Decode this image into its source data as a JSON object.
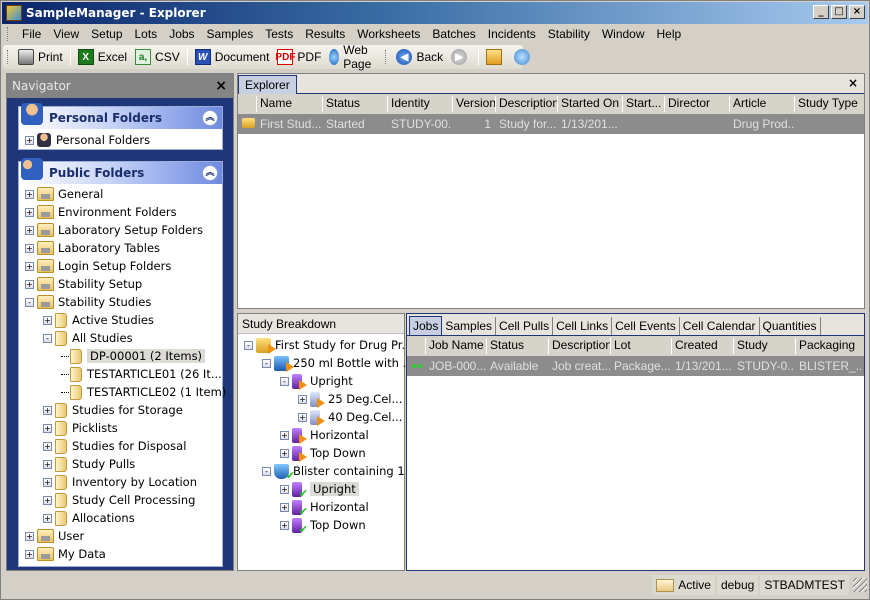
{
  "window": {
    "title": "SampleManager - Explorer",
    "controls": [
      "_",
      "□",
      "×"
    ]
  },
  "menubar": {
    "items": [
      "File",
      "View",
      "Setup",
      "Lots",
      "Jobs",
      "Samples",
      "Tests",
      "Results",
      "Worksheets",
      "Batches",
      "Incidents",
      "Stability",
      "Window",
      "Help"
    ]
  },
  "toolbar": {
    "print": "Print",
    "excel": "Excel",
    "csv": "CSV",
    "document": "Document",
    "pdf": "PDF",
    "webpage": "Web Page",
    "back": "Back"
  },
  "navigator": {
    "title": "Navigator",
    "close": "×",
    "personal": {
      "header": "Personal Folders",
      "items": [
        {
          "label": "Personal Folders"
        }
      ]
    },
    "public": {
      "header": "Public Folders",
      "items": [
        {
          "label": "General",
          "level": 0,
          "exp": "+"
        },
        {
          "label": "Environment Folders",
          "level": 0,
          "exp": "+"
        },
        {
          "label": "Laboratory Setup Folders",
          "level": 0,
          "exp": "+"
        },
        {
          "label": "Laboratory Tables",
          "level": 0,
          "exp": "+"
        },
        {
          "label": "Login Setup Folders",
          "level": 0,
          "exp": "+"
        },
        {
          "label": "Stability Setup",
          "level": 0,
          "exp": "+"
        },
        {
          "label": "Stability Studies",
          "level": 0,
          "exp": "-"
        },
        {
          "label": "Active Studies",
          "level": 1,
          "exp": "+"
        },
        {
          "label": "All Studies",
          "level": 1,
          "exp": "-"
        },
        {
          "label": "DP-00001 (2 Items)",
          "level": 2,
          "exp": "",
          "selected": true
        },
        {
          "label": "TESTARTICLE01 (26 It...",
          "level": 2,
          "exp": ""
        },
        {
          "label": "TESTARTICLE02 (1 Item)",
          "level": 2,
          "exp": ""
        },
        {
          "label": "Studies for Storage",
          "level": 1,
          "exp": "+"
        },
        {
          "label": "Picklists",
          "level": 1,
          "exp": "+"
        },
        {
          "label": "Studies for Disposal",
          "level": 1,
          "exp": "+"
        },
        {
          "label": "Study Pulls",
          "level": 1,
          "exp": "+"
        },
        {
          "label": "Inventory by Location",
          "level": 1,
          "exp": "+"
        },
        {
          "label": "Study Cell Processing",
          "level": 1,
          "exp": "+"
        },
        {
          "label": "Allocations",
          "level": 1,
          "exp": "+"
        },
        {
          "label": "User",
          "level": 0,
          "exp": "+"
        },
        {
          "label": "My Data",
          "level": 0,
          "exp": "+"
        }
      ]
    }
  },
  "explorer": {
    "tab": "Explorer",
    "close": "×",
    "columns": [
      "Name",
      "Status",
      "Identity",
      "Version",
      "Description",
      "Started On",
      "Start...",
      "Director",
      "Article",
      "Study Type"
    ],
    "rows": [
      [
        "First Stud...",
        "Started",
        "STUDY-00...",
        "1",
        "Study for...",
        "1/13/201...",
        "",
        "",
        "Drug Prod...",
        ""
      ]
    ]
  },
  "breakdown": {
    "title": "Study Breakdown",
    "items": [
      {
        "label": "First Study for Drug Pr...",
        "level": 0,
        "exp": "-",
        "icon": "study"
      },
      {
        "label": "250 ml Bottle with ...",
        "level": 1,
        "exp": "-",
        "icon": "pack"
      },
      {
        "label": "Upright",
        "level": 2,
        "exp": "-",
        "icon": "cond"
      },
      {
        "label": "25 Deg.Cel...",
        "level": 3,
        "exp": "+",
        "icon": "temp"
      },
      {
        "label": "40 Deg.Cel...",
        "level": 3,
        "exp": "+",
        "icon": "temp"
      },
      {
        "label": "Horizontal",
        "level": 2,
        "exp": "+",
        "icon": "cond"
      },
      {
        "label": "Top Down",
        "level": 2,
        "exp": "+",
        "icon": "cond"
      },
      {
        "label": "Blister containing 1...",
        "level": 1,
        "exp": "-",
        "icon": "shield"
      },
      {
        "label": "Upright",
        "level": 2,
        "exp": "+",
        "icon": "condok",
        "selected": true
      },
      {
        "label": "Horizontal",
        "level": 2,
        "exp": "+",
        "icon": "condok"
      },
      {
        "label": "Top Down",
        "level": 2,
        "exp": "+",
        "icon": "condok"
      }
    ]
  },
  "jobs": {
    "tabs": [
      "Jobs",
      "Samples",
      "Cell Pulls",
      "Cell Links",
      "Cell Events",
      "Cell Calendar",
      "Quantities"
    ],
    "active_tab": "Jobs",
    "columns": [
      "Job Name",
      "Status",
      "Description",
      "Lot",
      "Created",
      "Study",
      "Packaging"
    ],
    "rows": [
      [
        "JOB-000...",
        "Available",
        "Job creat...",
        "Package...",
        "1/13/201...",
        "STUDY-0...",
        "BLISTER_..."
      ]
    ]
  },
  "statusbar": {
    "state": "Active",
    "mode": "debug",
    "user": "STBADMTEST"
  }
}
